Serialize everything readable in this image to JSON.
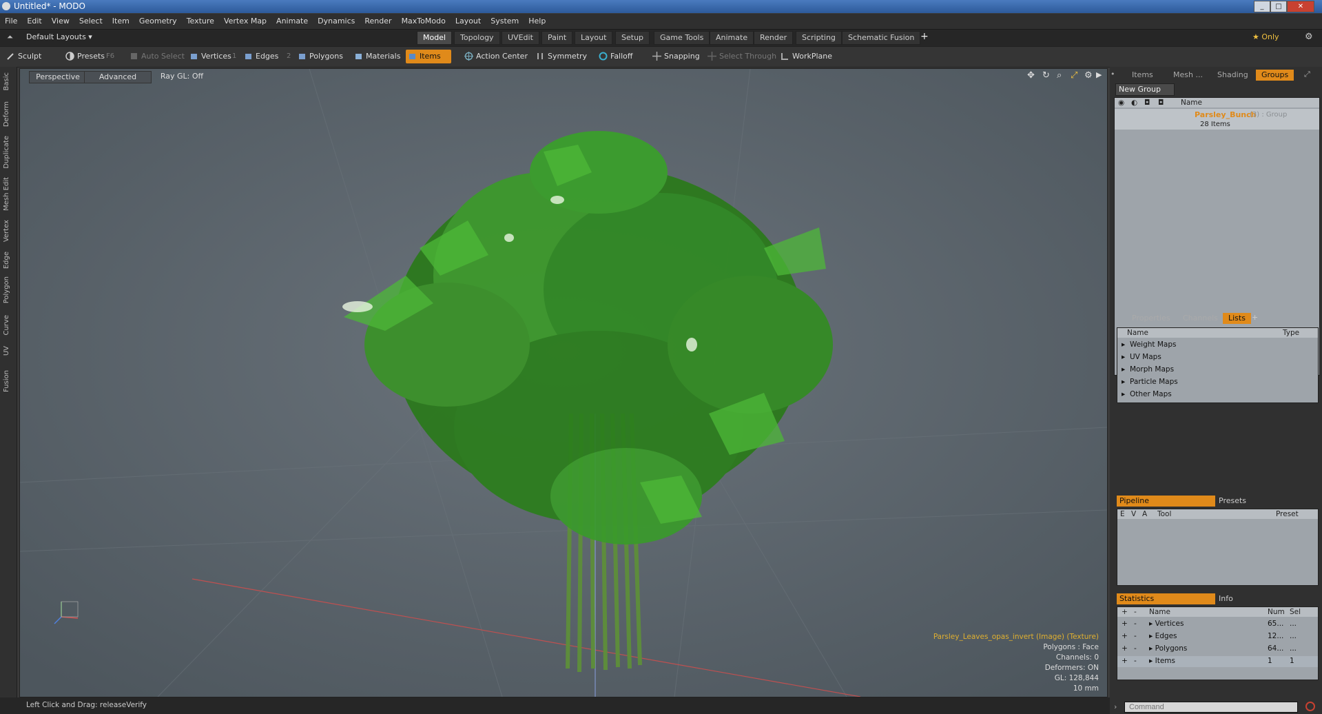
{
  "window": {
    "title": "Untitled* - MODO"
  },
  "menu": [
    "File",
    "Edit",
    "View",
    "Select",
    "Item",
    "Geometry",
    "Texture",
    "Vertex Map",
    "Animate",
    "Dynamics",
    "Render",
    "MaxToModo",
    "Layout",
    "System",
    "Help"
  ],
  "layoutbar": {
    "default_layouts": "Default Layouts ▾",
    "tabs": [
      "Model",
      "Topology",
      "UVEdit",
      "Paint",
      "Layout",
      "Setup",
      "Game Tools",
      "Animate",
      "Render",
      "Scripting",
      "Schematic Fusion"
    ],
    "active_tab": "Model",
    "add": "+",
    "only": "★ Only"
  },
  "toolbar": {
    "sculpt": "Sculpt",
    "presets": "Presets",
    "presets_key": "F6",
    "auto_select": "Auto Select",
    "vertices": "Vertices",
    "vertices_key": "1",
    "edges": "Edges",
    "edges_key": "2",
    "polygons": "Polygons",
    "materials": "Materials",
    "items": "Items",
    "action_center": "Action Center",
    "symmetry": "Symmetry",
    "falloff": "Falloff",
    "snapping": "Snapping",
    "select_through": "Select Through",
    "workplane": "WorkPlane"
  },
  "lefttabs": [
    "Basic",
    "Deform",
    "Duplicate",
    "Mesh Edit",
    "Vertex",
    "Edge",
    "Polygon",
    "Curve",
    "UV",
    "Fusion"
  ],
  "viewport": {
    "perspective": "Perspective",
    "advanced": "Advanced",
    "raygl": "Ray GL: Off",
    "info_lines": [
      "Parsley_Leaves_opas_invert (Image) (Texture)",
      "Polygons : Face",
      "Channels: 0",
      "Deformers: ON",
      "GL: 128,844",
      "10 mm"
    ]
  },
  "right_top": {
    "tabs": [
      "Items",
      "Mesh ...",
      "Shading",
      "Groups"
    ],
    "active": "Groups",
    "new_group": "New Group",
    "col_name": "Name",
    "group_name": "Parsley_Bunch",
    "group_suffix": "(3) : Group",
    "group_count": "28 Items"
  },
  "right_mid": {
    "tabs": [
      "Properties",
      "Channels",
      "Lists"
    ],
    "active": "Lists",
    "add": "+",
    "col_name": "Name",
    "col_type": "Type",
    "rows": [
      "Weight Maps",
      "UV Maps",
      "Morph Maps",
      "Particle Maps",
      "Other Maps"
    ]
  },
  "pipeline": {
    "tabs": [
      "Pipeline",
      "Presets"
    ],
    "cols": [
      "E",
      "V",
      "A",
      "Tool",
      "Preset"
    ]
  },
  "statistics": {
    "tabs": [
      "Statistics",
      "Info"
    ],
    "cols": [
      "Name",
      "Num",
      "Sel"
    ],
    "rows": [
      {
        "name": "Vertices",
        "num": "65...",
        "sel": "..."
      },
      {
        "name": "Edges",
        "num": "12...",
        "sel": "..."
      },
      {
        "name": "Polygons",
        "num": "64...",
        "sel": "..."
      },
      {
        "name": "Items",
        "num": "1",
        "sel": "1"
      }
    ]
  },
  "status": {
    "hint": "Left Click and Drag:  releaseVerify"
  },
  "command": {
    "placeholder": "Command"
  },
  "colors": {
    "accent": "#e08a1a",
    "viewport_bg": "#566068",
    "leaf_green": "#2f8a1f"
  }
}
